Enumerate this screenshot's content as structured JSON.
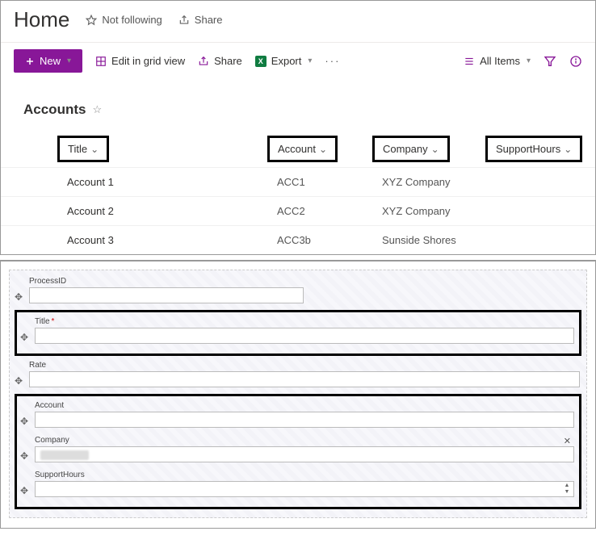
{
  "header": {
    "title": "Home",
    "not_following": "Not following",
    "share": "Share"
  },
  "toolbar": {
    "new": "New",
    "edit_grid": "Edit in grid view",
    "share": "Share",
    "export": "Export",
    "view": "All Items"
  },
  "list": {
    "title": "Accounts",
    "columns": {
      "title": "Title",
      "account": "Account",
      "company": "Company",
      "support": "SupportHours"
    },
    "rows": [
      {
        "title": "Account 1",
        "account": "ACC1",
        "company": "XYZ Company",
        "support": ""
      },
      {
        "title": "Account 2",
        "account": "ACC2",
        "company": "XYZ Company",
        "support": ""
      },
      {
        "title": "Account 3",
        "account": "ACC3b",
        "company": "Sunside Shores",
        "support": ""
      }
    ]
  },
  "form": {
    "processid": "ProcessID",
    "title": "Title",
    "rate": "Rate",
    "account": "Account",
    "company": "Company",
    "support": "SupportHours"
  }
}
